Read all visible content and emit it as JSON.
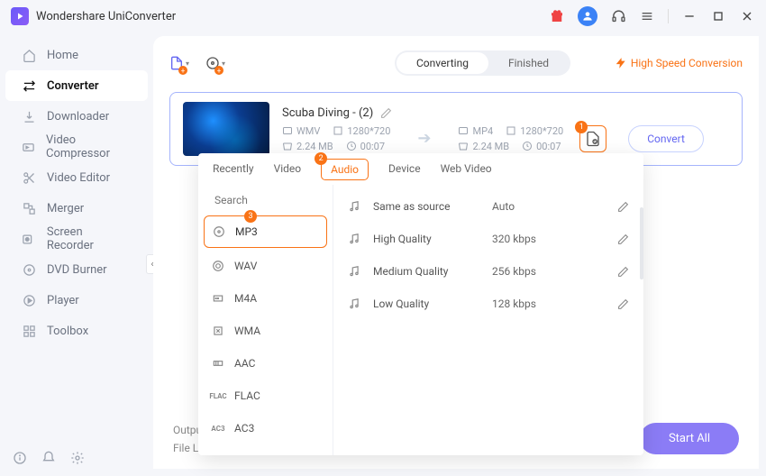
{
  "app_title": "Wondershare UniConverter",
  "titlebar": {
    "gift_icon": "gift-icon",
    "avatar_initial": "•",
    "support_icon": "headset-icon",
    "menu_icon": "menu-icon"
  },
  "sidebar": {
    "items": [
      {
        "icon": "home-icon",
        "label": "Home"
      },
      {
        "icon": "converter-icon",
        "label": "Converter",
        "active": true
      },
      {
        "icon": "download-icon",
        "label": "Downloader"
      },
      {
        "icon": "compress-icon",
        "label": "Video Compressor"
      },
      {
        "icon": "scissors-icon",
        "label": "Video Editor"
      },
      {
        "icon": "merge-icon",
        "label": "Merger"
      },
      {
        "icon": "record-icon",
        "label": "Screen Recorder"
      },
      {
        "icon": "disc-icon",
        "label": "DVD Burner"
      },
      {
        "icon": "play-icon",
        "label": "Player"
      },
      {
        "icon": "grid-icon",
        "label": "Toolbox"
      }
    ]
  },
  "toolbar": {
    "segments": {
      "converting": "Converting",
      "finished": "Finished",
      "active": "converting"
    },
    "high_speed": "High Speed Conversion"
  },
  "file": {
    "name": "Scuba Diving - (2)",
    "source": {
      "format": "WMV",
      "resolution": "1280*720",
      "size": "2.24 MB",
      "duration": "00:07"
    },
    "target": {
      "format": "MP4",
      "resolution": "1280*720",
      "size": "2.24 MB",
      "duration": "00:07"
    },
    "settings_badge": "1",
    "convert_label": "Convert"
  },
  "format_panel": {
    "tabs": [
      "Recently",
      "Video",
      "Audio",
      "Device",
      "Web Video"
    ],
    "active_tab": "Audio",
    "audio_tab_badge": "2",
    "search_placeholder": "Search",
    "formats": [
      "MP3",
      "WAV",
      "M4A",
      "WMA",
      "AAC",
      "FLAC",
      "AC3"
    ],
    "active_format": "MP3",
    "mp3_badge": "3",
    "qualities": [
      {
        "name": "Same as source",
        "value": "Auto"
      },
      {
        "name": "High Quality",
        "value": "320 kbps"
      },
      {
        "name": "Medium Quality",
        "value": "256 kbps"
      },
      {
        "name": "Low Quality",
        "value": "128 kbps"
      }
    ]
  },
  "footer": {
    "output_label": "Output",
    "file_loc_label": "File Loc",
    "start_all": "Start All"
  }
}
